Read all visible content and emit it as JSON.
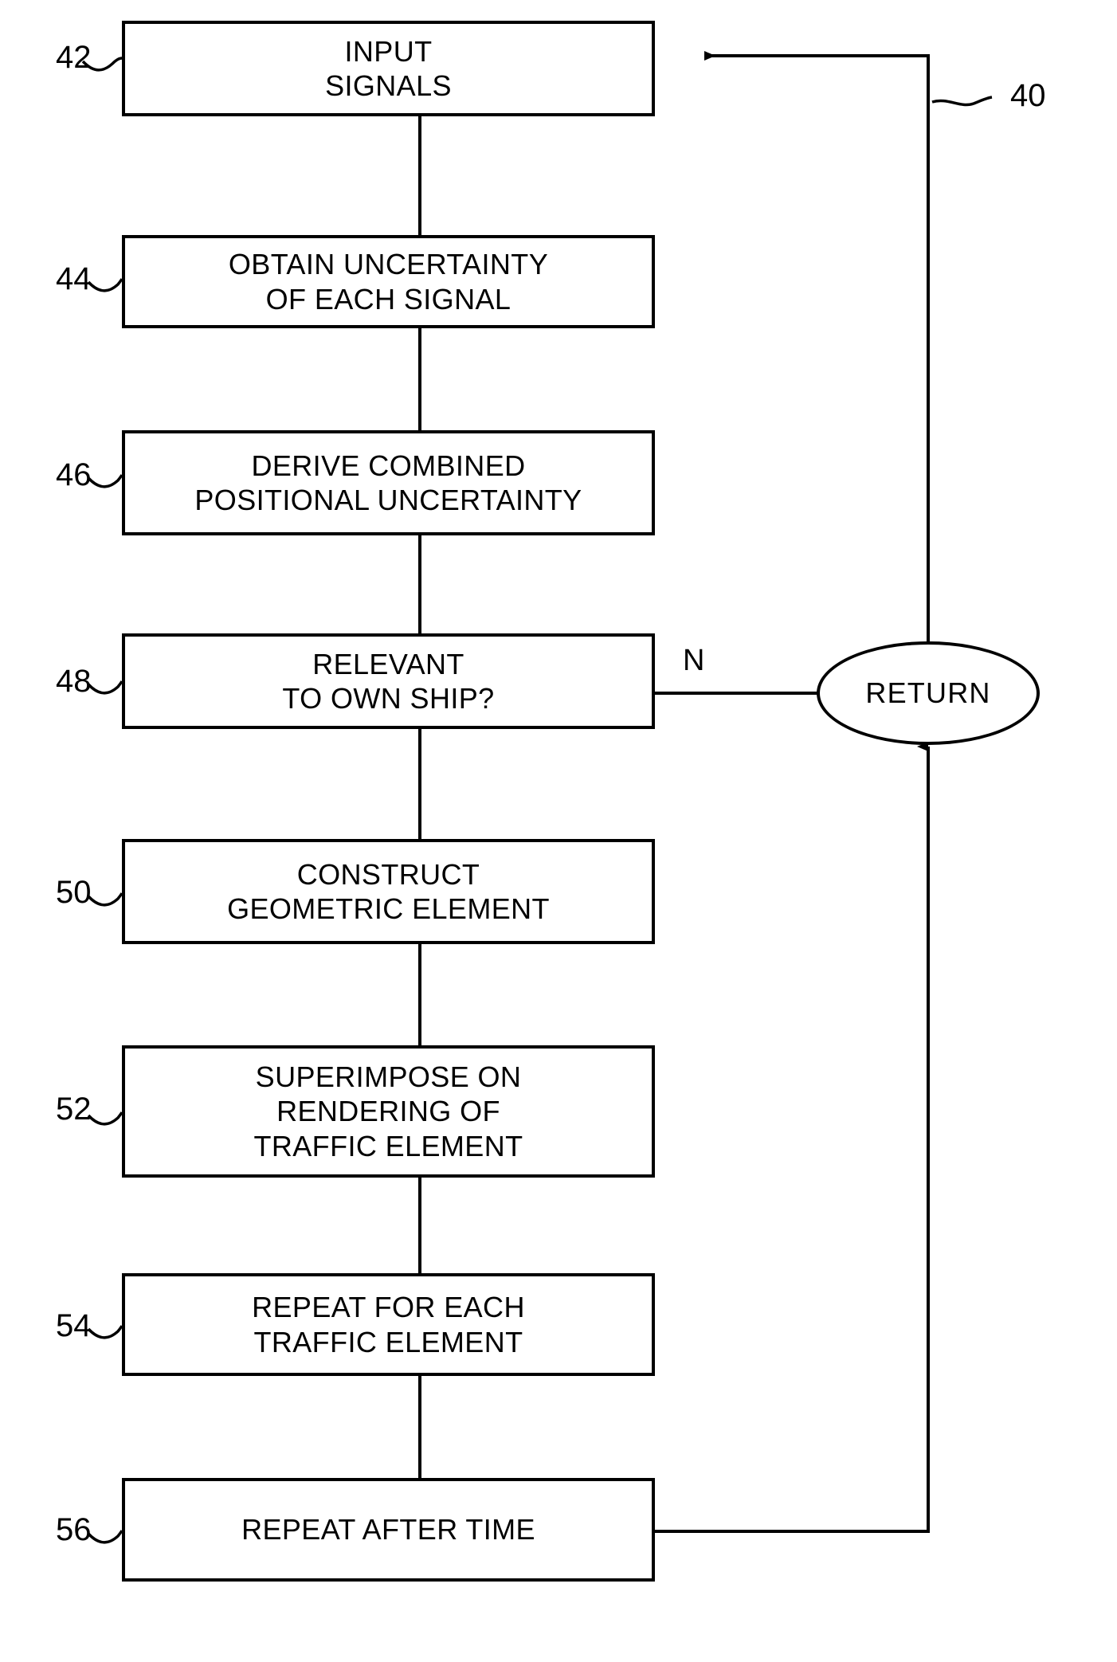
{
  "figure": {
    "reference_numeral": "40",
    "branch_label_no": "N"
  },
  "nodes": [
    {
      "ref": "42",
      "name": "input-signals",
      "lines": [
        "INPUT",
        "SIGNALS"
      ]
    },
    {
      "ref": "44",
      "name": "obtain-uncertainty",
      "lines": [
        "OBTAIN UNCERTAINTY",
        "OF EACH SIGNAL"
      ]
    },
    {
      "ref": "46",
      "name": "derive-combined-positional-uncertainty",
      "lines": [
        "DERIVE COMBINED",
        "POSITIONAL UNCERTAINTY"
      ]
    },
    {
      "ref": "48",
      "name": "relevant-to-own-ship",
      "lines": [
        "RELEVANT",
        "TO OWN SHIP?"
      ]
    },
    {
      "ref": "50",
      "name": "construct-geometric-element",
      "lines": [
        "CONSTRUCT",
        "GEOMETRIC ELEMENT"
      ]
    },
    {
      "ref": "52",
      "name": "superimpose-on-rendering",
      "lines": [
        "SUPERIMPOSE ON",
        "RENDERING OF",
        "TRAFFIC ELEMENT"
      ]
    },
    {
      "ref": "54",
      "name": "repeat-for-each-traffic-element",
      "lines": [
        "REPEAT FOR EACH",
        "TRAFFIC ELEMENT"
      ]
    },
    {
      "ref": "56",
      "name": "repeat-after-time",
      "lines": [
        "REPEAT AFTER TIME"
      ]
    }
  ],
  "terminal": {
    "ref": "return",
    "label": "RETURN"
  },
  "colors": {
    "stroke": "#000000",
    "fill": "#ffffff"
  }
}
